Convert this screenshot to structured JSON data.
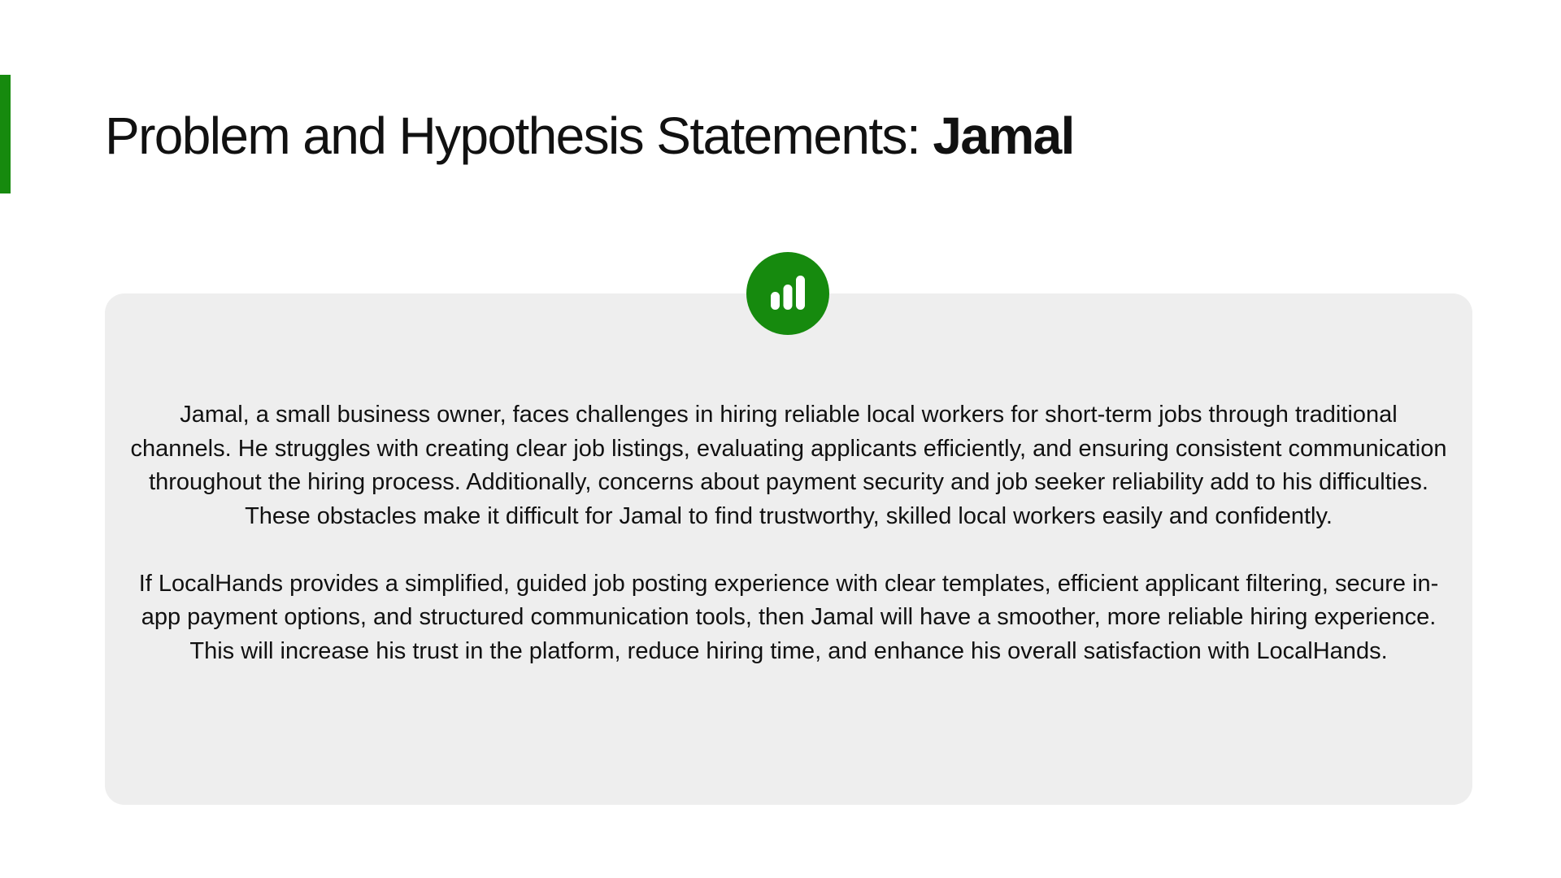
{
  "slide": {
    "title_regular": "Problem and Hypothesis Statements: ",
    "title_bold": "Jamal",
    "accent_color": "#168a0e",
    "icon": "bar-chart-icon",
    "problem_statement": "Jamal, a small business owner, faces challenges in hiring reliable local workers for short-term jobs through traditional channels. He struggles with creating clear job listings, evaluating applicants efficiently, and ensuring consistent communication throughout the hiring process. Additionally, concerns about payment security and job seeker reliability add to his difficulties. These obstacles make it difficult for Jamal to find trustworthy, skilled local workers easily and confidently.",
    "hypothesis_statement": "If LocalHands provides a simplified, guided job posting experience with clear templates, efficient applicant filtering, secure in-app payment options, and structured communication tools, then Jamal will have a smoother, more reliable hiring experience. This will increase his trust in the platform, reduce hiring time, and enhance his overall satisfaction with LocalHands."
  }
}
